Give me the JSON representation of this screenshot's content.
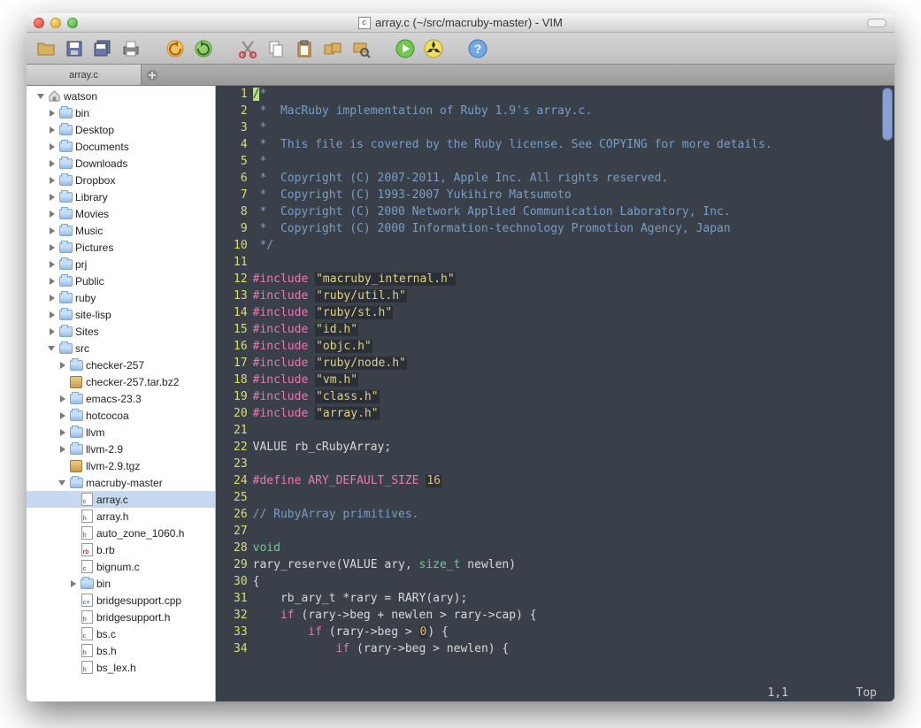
{
  "window": {
    "title": "array.c (~/src/macruby-master) - VIM"
  },
  "tab": {
    "label": "array.c"
  },
  "tree": [
    {
      "depth": 0,
      "twist": "open",
      "icon": "home",
      "label": "watson"
    },
    {
      "depth": 1,
      "twist": "closed",
      "icon": "folder",
      "label": "bin"
    },
    {
      "depth": 1,
      "twist": "closed",
      "icon": "folder",
      "label": "Desktop"
    },
    {
      "depth": 1,
      "twist": "closed",
      "icon": "folder",
      "label": "Documents"
    },
    {
      "depth": 1,
      "twist": "closed",
      "icon": "folder",
      "label": "Downloads"
    },
    {
      "depth": 1,
      "twist": "closed",
      "icon": "folder",
      "label": "Dropbox"
    },
    {
      "depth": 1,
      "twist": "closed",
      "icon": "folder",
      "label": "Library"
    },
    {
      "depth": 1,
      "twist": "closed",
      "icon": "folder",
      "label": "Movies"
    },
    {
      "depth": 1,
      "twist": "closed",
      "icon": "folder",
      "label": "Music"
    },
    {
      "depth": 1,
      "twist": "closed",
      "icon": "folder",
      "label": "Pictures"
    },
    {
      "depth": 1,
      "twist": "closed",
      "icon": "folder",
      "label": "prj"
    },
    {
      "depth": 1,
      "twist": "closed",
      "icon": "folder",
      "label": "Public"
    },
    {
      "depth": 1,
      "twist": "closed",
      "icon": "folder",
      "label": "ruby"
    },
    {
      "depth": 1,
      "twist": "closed",
      "icon": "folder",
      "label": "site-lisp"
    },
    {
      "depth": 1,
      "twist": "closed",
      "icon": "folder",
      "label": "Sites"
    },
    {
      "depth": 1,
      "twist": "open",
      "icon": "folder",
      "label": "src"
    },
    {
      "depth": 2,
      "twist": "closed",
      "icon": "folder",
      "label": "checker-257"
    },
    {
      "depth": 2,
      "twist": "none",
      "icon": "archive",
      "label": "checker-257.tar.bz2"
    },
    {
      "depth": 2,
      "twist": "closed",
      "icon": "folder",
      "label": "emacs-23.3"
    },
    {
      "depth": 2,
      "twist": "closed",
      "icon": "folder",
      "label": "hotcocoa"
    },
    {
      "depth": 2,
      "twist": "closed",
      "icon": "folder",
      "label": "llvm"
    },
    {
      "depth": 2,
      "twist": "closed",
      "icon": "folder",
      "label": "llvm-2.9"
    },
    {
      "depth": 2,
      "twist": "none",
      "icon": "archive",
      "label": "llvm-2.9.tgz"
    },
    {
      "depth": 2,
      "twist": "open",
      "icon": "folder",
      "label": "macruby-master"
    },
    {
      "depth": 3,
      "twist": "none",
      "icon": "file-c",
      "label": "array.c",
      "selected": true
    },
    {
      "depth": 3,
      "twist": "none",
      "icon": "file-h",
      "label": "array.h"
    },
    {
      "depth": 3,
      "twist": "none",
      "icon": "file-h",
      "label": "auto_zone_1060.h"
    },
    {
      "depth": 3,
      "twist": "none",
      "icon": "file-rb",
      "label": "b.rb"
    },
    {
      "depth": 3,
      "twist": "none",
      "icon": "file-c",
      "label": "bignum.c"
    },
    {
      "depth": 3,
      "twist": "closed",
      "icon": "folder",
      "label": "bin"
    },
    {
      "depth": 3,
      "twist": "none",
      "icon": "file-cpp",
      "label": "bridgesupport.cpp"
    },
    {
      "depth": 3,
      "twist": "none",
      "icon": "file-h",
      "label": "bridgesupport.h"
    },
    {
      "depth": 3,
      "twist": "none",
      "icon": "file-c",
      "label": "bs.c"
    },
    {
      "depth": 3,
      "twist": "none",
      "icon": "file-h",
      "label": "bs.h"
    },
    {
      "depth": 3,
      "twist": "none",
      "icon": "file-h",
      "label": "bs_lex.h"
    }
  ],
  "code_lines": [
    {
      "n": 1,
      "html": "<span class='cursor-block'>/</span><span class='c-comment'>*</span>"
    },
    {
      "n": 2,
      "html": "<span class='c-comment'> *  MacRuby implementation of Ruby 1.9's array.c.</span>"
    },
    {
      "n": 3,
      "html": "<span class='c-comment'> *</span>"
    },
    {
      "n": 4,
      "html": "<span class='c-comment'> *  This file is covered by the Ruby license. See COPYING for more details.</span>"
    },
    {
      "n": 5,
      "html": "<span class='c-comment'> *</span>"
    },
    {
      "n": 6,
      "html": "<span class='c-comment'> *  Copyright (C) 2007-2011, Apple Inc. All rights reserved.</span>"
    },
    {
      "n": 7,
      "html": "<span class='c-comment'> *  Copyright (C) 1993-2007 Yukihiro Matsumoto</span>"
    },
    {
      "n": 8,
      "html": "<span class='c-comment'> *  Copyright (C) 2000 Network Applied Communication Laboratory, Inc.</span>"
    },
    {
      "n": 9,
      "html": "<span class='c-comment'> *  Copyright (C) 2000 Information-technology Promotion Agency, Japan</span>"
    },
    {
      "n": 10,
      "html": "<span class='c-comment'> */</span>"
    },
    {
      "n": 11,
      "html": ""
    },
    {
      "n": 12,
      "html": "<span class='c-pp'>#include </span><span class='c-str'>\"macruby_internal.h\"</span>"
    },
    {
      "n": 13,
      "html": "<span class='c-pp'>#include </span><span class='c-str'>\"ruby/util.h\"</span>"
    },
    {
      "n": 14,
      "html": "<span class='c-pp'>#include </span><span class='c-str'>\"ruby/st.h\"</span>"
    },
    {
      "n": 15,
      "html": "<span class='c-pp'>#include </span><span class='c-str'>\"id.h\"</span>"
    },
    {
      "n": 16,
      "html": "<span class='c-pp'>#include </span><span class='c-str'>\"objc.h\"</span>"
    },
    {
      "n": 17,
      "html": "<span class='c-pp'>#include </span><span class='c-str'>\"ruby/node.h\"</span>"
    },
    {
      "n": 18,
      "html": "<span class='c-pp'>#include </span><span class='c-str'>\"vm.h\"</span>"
    },
    {
      "n": 19,
      "html": "<span class='c-pp'>#include </span><span class='c-str'>\"class.h\"</span>"
    },
    {
      "n": 20,
      "html": "<span class='c-pp'>#include </span><span class='c-str'>\"array.h\"</span>"
    },
    {
      "n": 21,
      "html": ""
    },
    {
      "n": 22,
      "html": "VALUE rb_cRubyArray;"
    },
    {
      "n": 23,
      "html": ""
    },
    {
      "n": 24,
      "html": "<span class='c-pp'>#define</span> <span class='c-kw'>ARY_DEFAULT_SIZE</span> <span class='c-num'>16</span>"
    },
    {
      "n": 25,
      "html": ""
    },
    {
      "n": 26,
      "html": "<span class='c-comment'>// RubyArray primitives.</span>"
    },
    {
      "n": 27,
      "html": ""
    },
    {
      "n": 28,
      "html": "<span class='c-type'>void</span>"
    },
    {
      "n": 29,
      "html": "rary_reserve(VALUE ary, <span class='c-type'>size_t</span> newlen)"
    },
    {
      "n": 30,
      "html": "{"
    },
    {
      "n": 31,
      "html": "    rb_ary_t *rary = RARY(ary);"
    },
    {
      "n": 32,
      "html": "    <span class='c-kw'>if</span> (rary-&gt;beg + newlen &gt; rary-&gt;cap) {"
    },
    {
      "n": 33,
      "html": "        <span class='c-kw'>if</span> (rary-&gt;beg &gt; <span class='c-num'>0</span>) {"
    },
    {
      "n": 34,
      "html": "            <span class='c-kw'>if</span> (rary-&gt;beg &gt; newlen) {"
    }
  ],
  "status": {
    "pos": "1,1",
    "top": "Top"
  }
}
